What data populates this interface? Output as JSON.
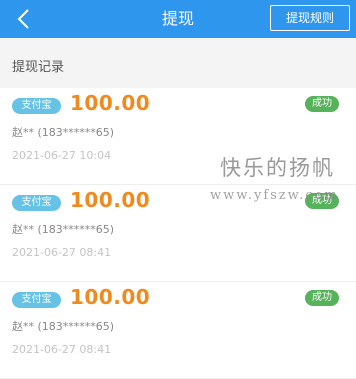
{
  "header": {
    "title": "提现",
    "rules_label": "提现规则",
    "back_icon": "chevron-left-icon",
    "background": "#2f96ee"
  },
  "section": {
    "title": "提现记录"
  },
  "records": [
    {
      "pay_method": "支付宝",
      "amount": "100.00",
      "status": "成功",
      "account": "赵** (183******65)",
      "time": "2021-06-27 10:04"
    },
    {
      "pay_method": "支付宝",
      "amount": "100.00",
      "status": "成功",
      "account": "赵** (183******65)",
      "time": "2021-06-27 08:41"
    },
    {
      "pay_method": "支付宝",
      "amount": "100.00",
      "status": "成功",
      "account": "赵** (183******65)",
      "time": "2021-06-27 08:41"
    }
  ],
  "watermark": {
    "line1": "快乐的扬帆",
    "line2": "www.yfszw.com"
  },
  "colors": {
    "amount": "#f08a1c",
    "status_badge": "#56b25b",
    "pay_badge": "#66c3e6"
  }
}
